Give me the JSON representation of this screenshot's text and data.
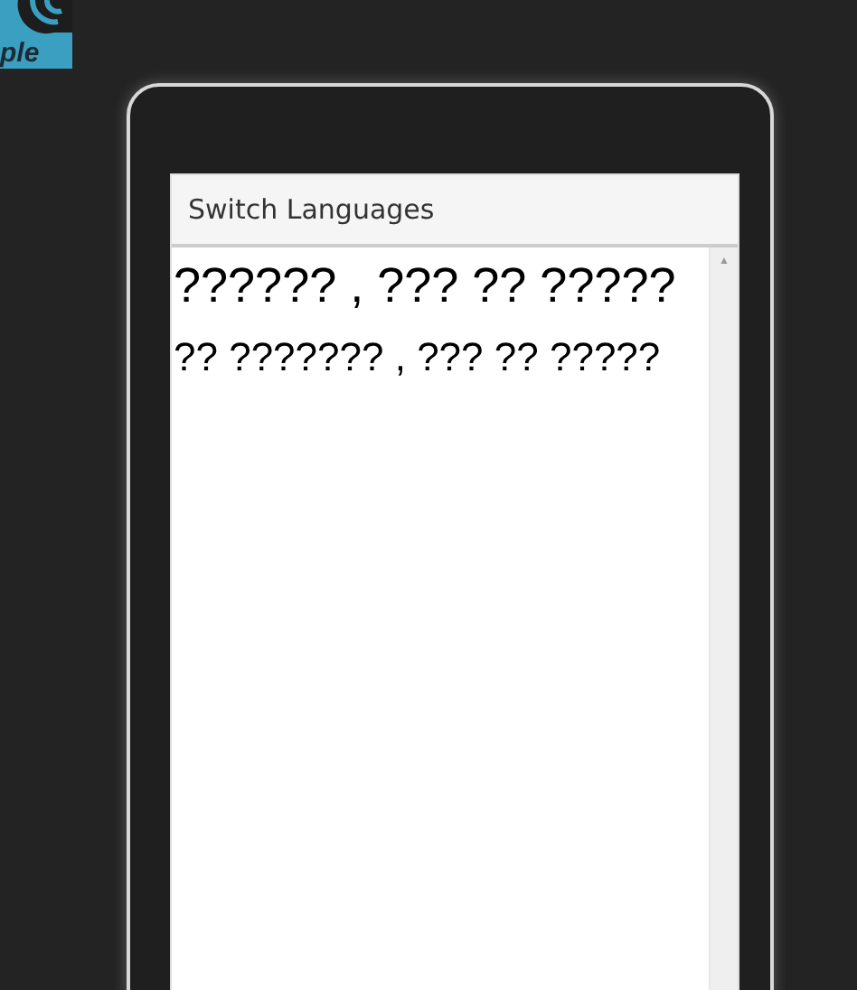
{
  "logo": {
    "text": "ple"
  },
  "window": {
    "title": "Switch Languages"
  },
  "lines": [
    {
      "text": "?????? , ??? ?? ?????",
      "kind": "heading"
    },
    {
      "text": "?? ??????? , ??? ?? ?????",
      "kind": "body"
    }
  ],
  "scrollbar": {
    "up_arrow": "▲"
  }
}
